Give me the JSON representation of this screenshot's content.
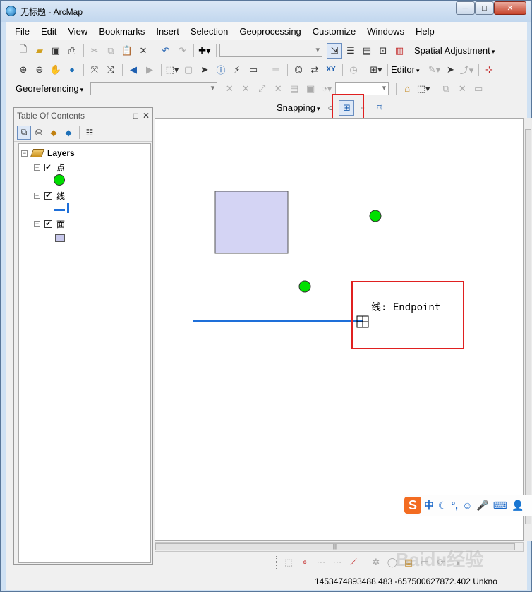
{
  "window": {
    "title": "无标题 - ArcMap",
    "minimize": "─",
    "maximize": "□",
    "close": "✕"
  },
  "menu": [
    "File",
    "Edit",
    "View",
    "Bookmarks",
    "Insert",
    "Selection",
    "Geoprocessing",
    "Customize",
    "Windows",
    "Help"
  ],
  "toolbars": {
    "standard": {
      "scale_value": "",
      "spatial_adjustment_label": "Spatial Adjustment"
    },
    "tools": {
      "editor_label": "Editor"
    },
    "georef": {
      "label": "Georeferencing",
      "layer_value": ""
    },
    "snapping": {
      "label": "Snapping"
    }
  },
  "toc": {
    "title": "Table Of Contents",
    "root": "Layers",
    "layers": [
      {
        "name": "点",
        "checked": true,
        "symbol": "point",
        "color": "#00dd00"
      },
      {
        "name": "线",
        "checked": true,
        "symbol": "line",
        "color": "#1e6fd9"
      },
      {
        "name": "面",
        "checked": true,
        "symbol": "polygon",
        "color": "#c8c8ec"
      }
    ]
  },
  "map": {
    "snap_tip": "线: Endpoint",
    "polygon_color": "#d4d4f4",
    "point_color": "#00e000",
    "line_color": "#1e6fd9"
  },
  "status": {
    "coords": "1453474893488.483 -657500627872.402 Unkno"
  },
  "ime": {
    "lang": "中"
  },
  "watermark": "Baidu经验"
}
